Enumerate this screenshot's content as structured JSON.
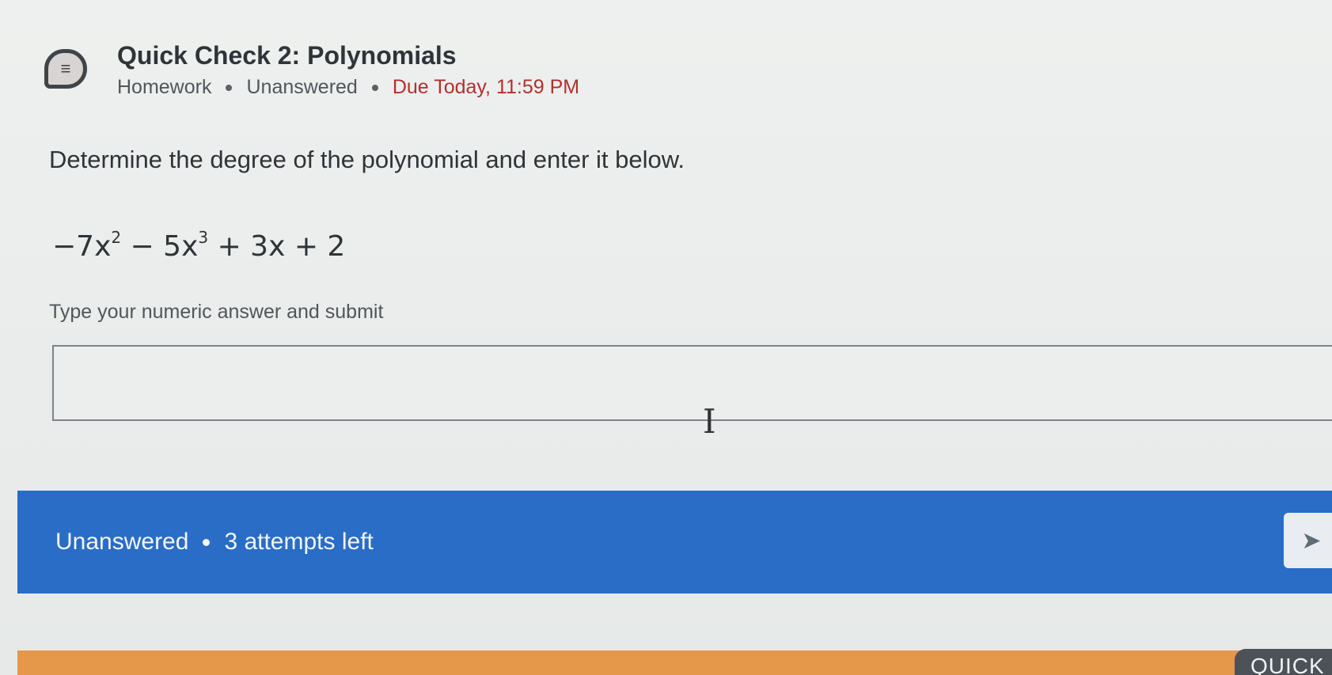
{
  "header": {
    "icon": "list-bubble-icon",
    "title": "Quick Check 2: Polynomials",
    "type": "Homework",
    "status": "Unanswered",
    "due": "Due Today, 11:59 PM"
  },
  "question": {
    "prompt": "Determine the degree of the polynomial and enter it below.",
    "expression": {
      "t1_coef": "−7x",
      "t1_exp": "2",
      "op1": " − ",
      "t2_coef": "5x",
      "t2_exp": "3",
      "rest": " + 3x + 2"
    },
    "hint": "Type your numeric answer and submit",
    "answer_value": ""
  },
  "status_bar": {
    "status": "Unanswered",
    "attempts": "3 attempts left",
    "submit_icon": "send-icon"
  },
  "bottom_tab": {
    "label": "QUICK"
  },
  "colors": {
    "accent_blue": "#2a6dc6",
    "due_red": "#b3302f",
    "bottom_orange": "#e5974a"
  }
}
